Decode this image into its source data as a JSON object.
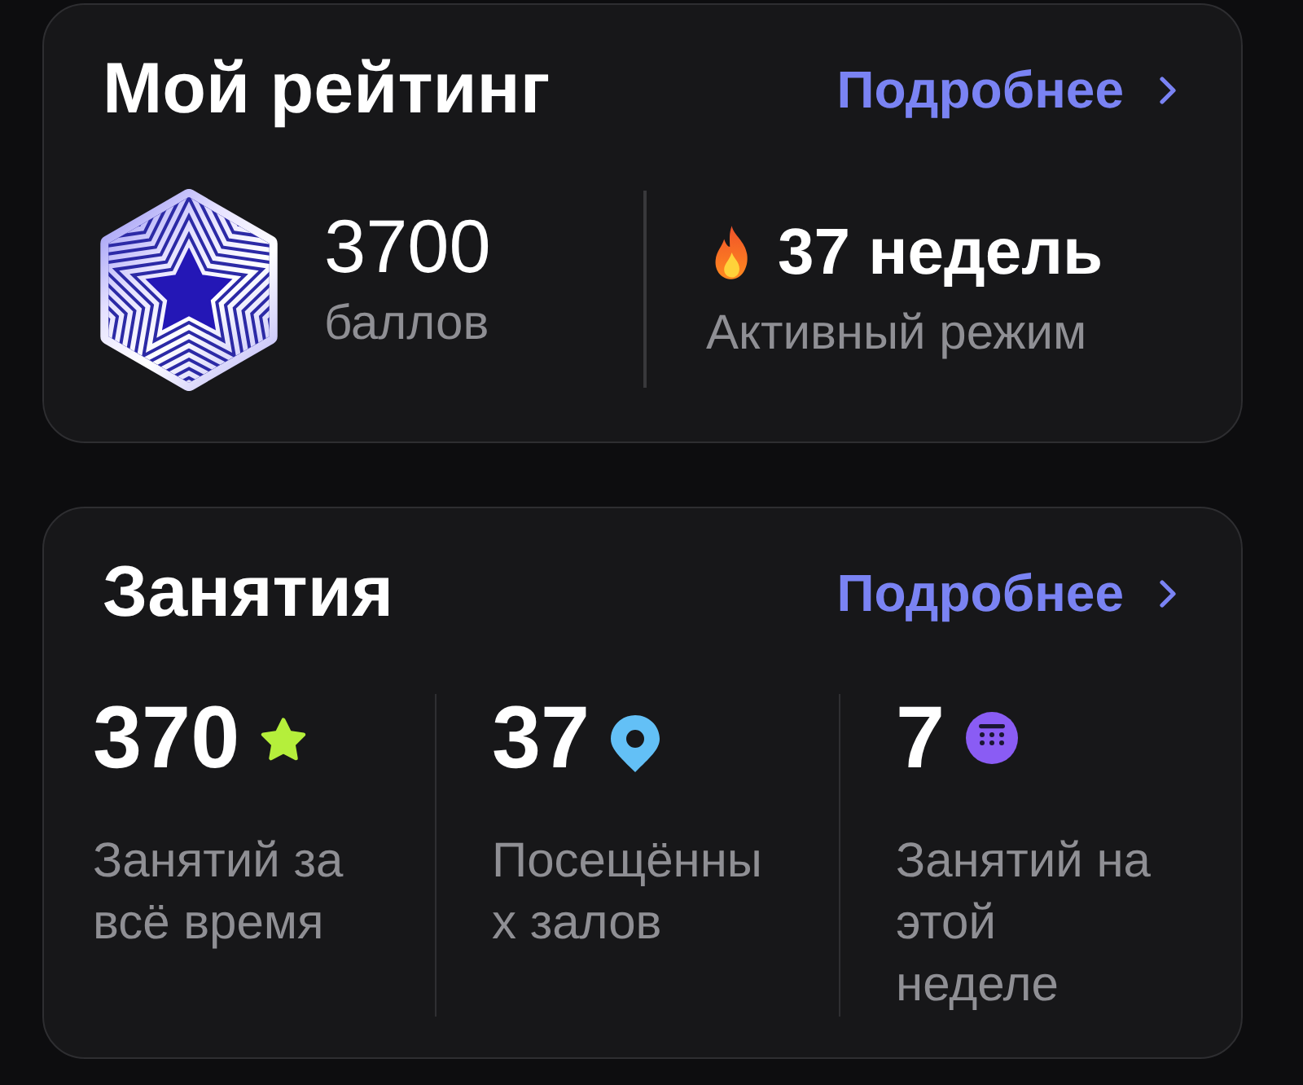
{
  "rating_card": {
    "title": "Мой рейтинг",
    "link": "Подробнее",
    "points": {
      "value": "3700",
      "label": "баллов"
    },
    "streak": {
      "value": "37 недель",
      "label": "Активный режим"
    }
  },
  "classes_card": {
    "title": "Занятия",
    "link": "Подробнее",
    "stats": [
      {
        "kind": "total",
        "value": "370",
        "label_lines": [
          "Занятий за",
          "всё время"
        ]
      },
      {
        "kind": "places",
        "value": "37",
        "label_lines": [
          "Посещённы",
          "х залов"
        ]
      },
      {
        "kind": "weekly",
        "value": "7",
        "label_lines": [
          "Занятий на",
          "этой",
          "неделе"
        ]
      }
    ]
  }
}
